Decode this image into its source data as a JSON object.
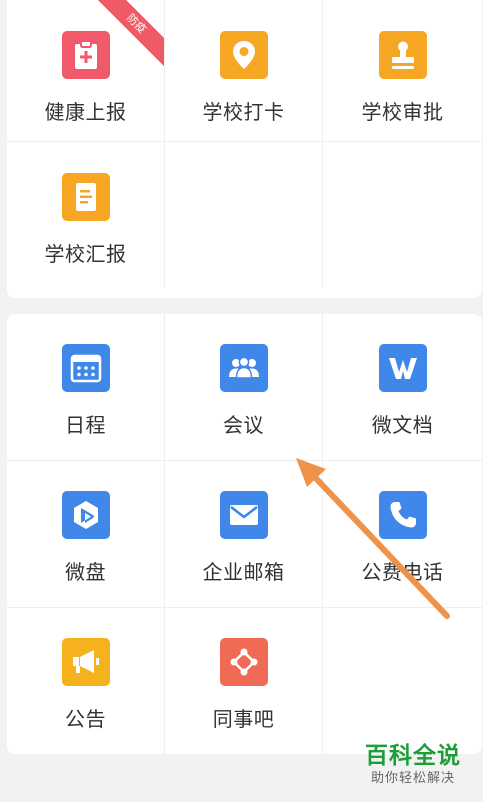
{
  "section1": {
    "items": [
      {
        "label": "健康上报",
        "icon": "clipboard-plus-icon",
        "color": "#f05a6a",
        "badge": "防疫"
      },
      {
        "label": "学校打卡",
        "icon": "location-pin-icon",
        "color": "#f5a623"
      },
      {
        "label": "学校审批",
        "icon": "stamp-icon",
        "color": "#f5a623"
      },
      {
        "label": "学校汇报",
        "icon": "report-document-icon",
        "color": "#f5a623"
      }
    ]
  },
  "section2": {
    "items": [
      {
        "label": "日程",
        "icon": "calendar-icon",
        "color": "#3f87e8"
      },
      {
        "label": "会议",
        "icon": "people-group-icon",
        "color": "#3f87e8"
      },
      {
        "label": "微文档",
        "icon": "word-w-icon",
        "color": "#3f87e8"
      },
      {
        "label": "微盘",
        "icon": "cloud-drive-icon",
        "color": "#3f87e8"
      },
      {
        "label": "企业邮箱",
        "icon": "envelope-icon",
        "color": "#3f87e8"
      },
      {
        "label": "公费电话",
        "icon": "phone-icon",
        "color": "#3f87e8"
      },
      {
        "label": "公告",
        "icon": "megaphone-icon",
        "color": "#f5b21c"
      },
      {
        "label": "同事吧",
        "icon": "network-diamond-icon",
        "color": "#f06a55"
      }
    ]
  },
  "overlay": {
    "arrow_color": "#f0934a"
  },
  "watermark": {
    "title": "百科全说",
    "subtitle": "助你轻松解决",
    "color": "#1e9e3a"
  }
}
